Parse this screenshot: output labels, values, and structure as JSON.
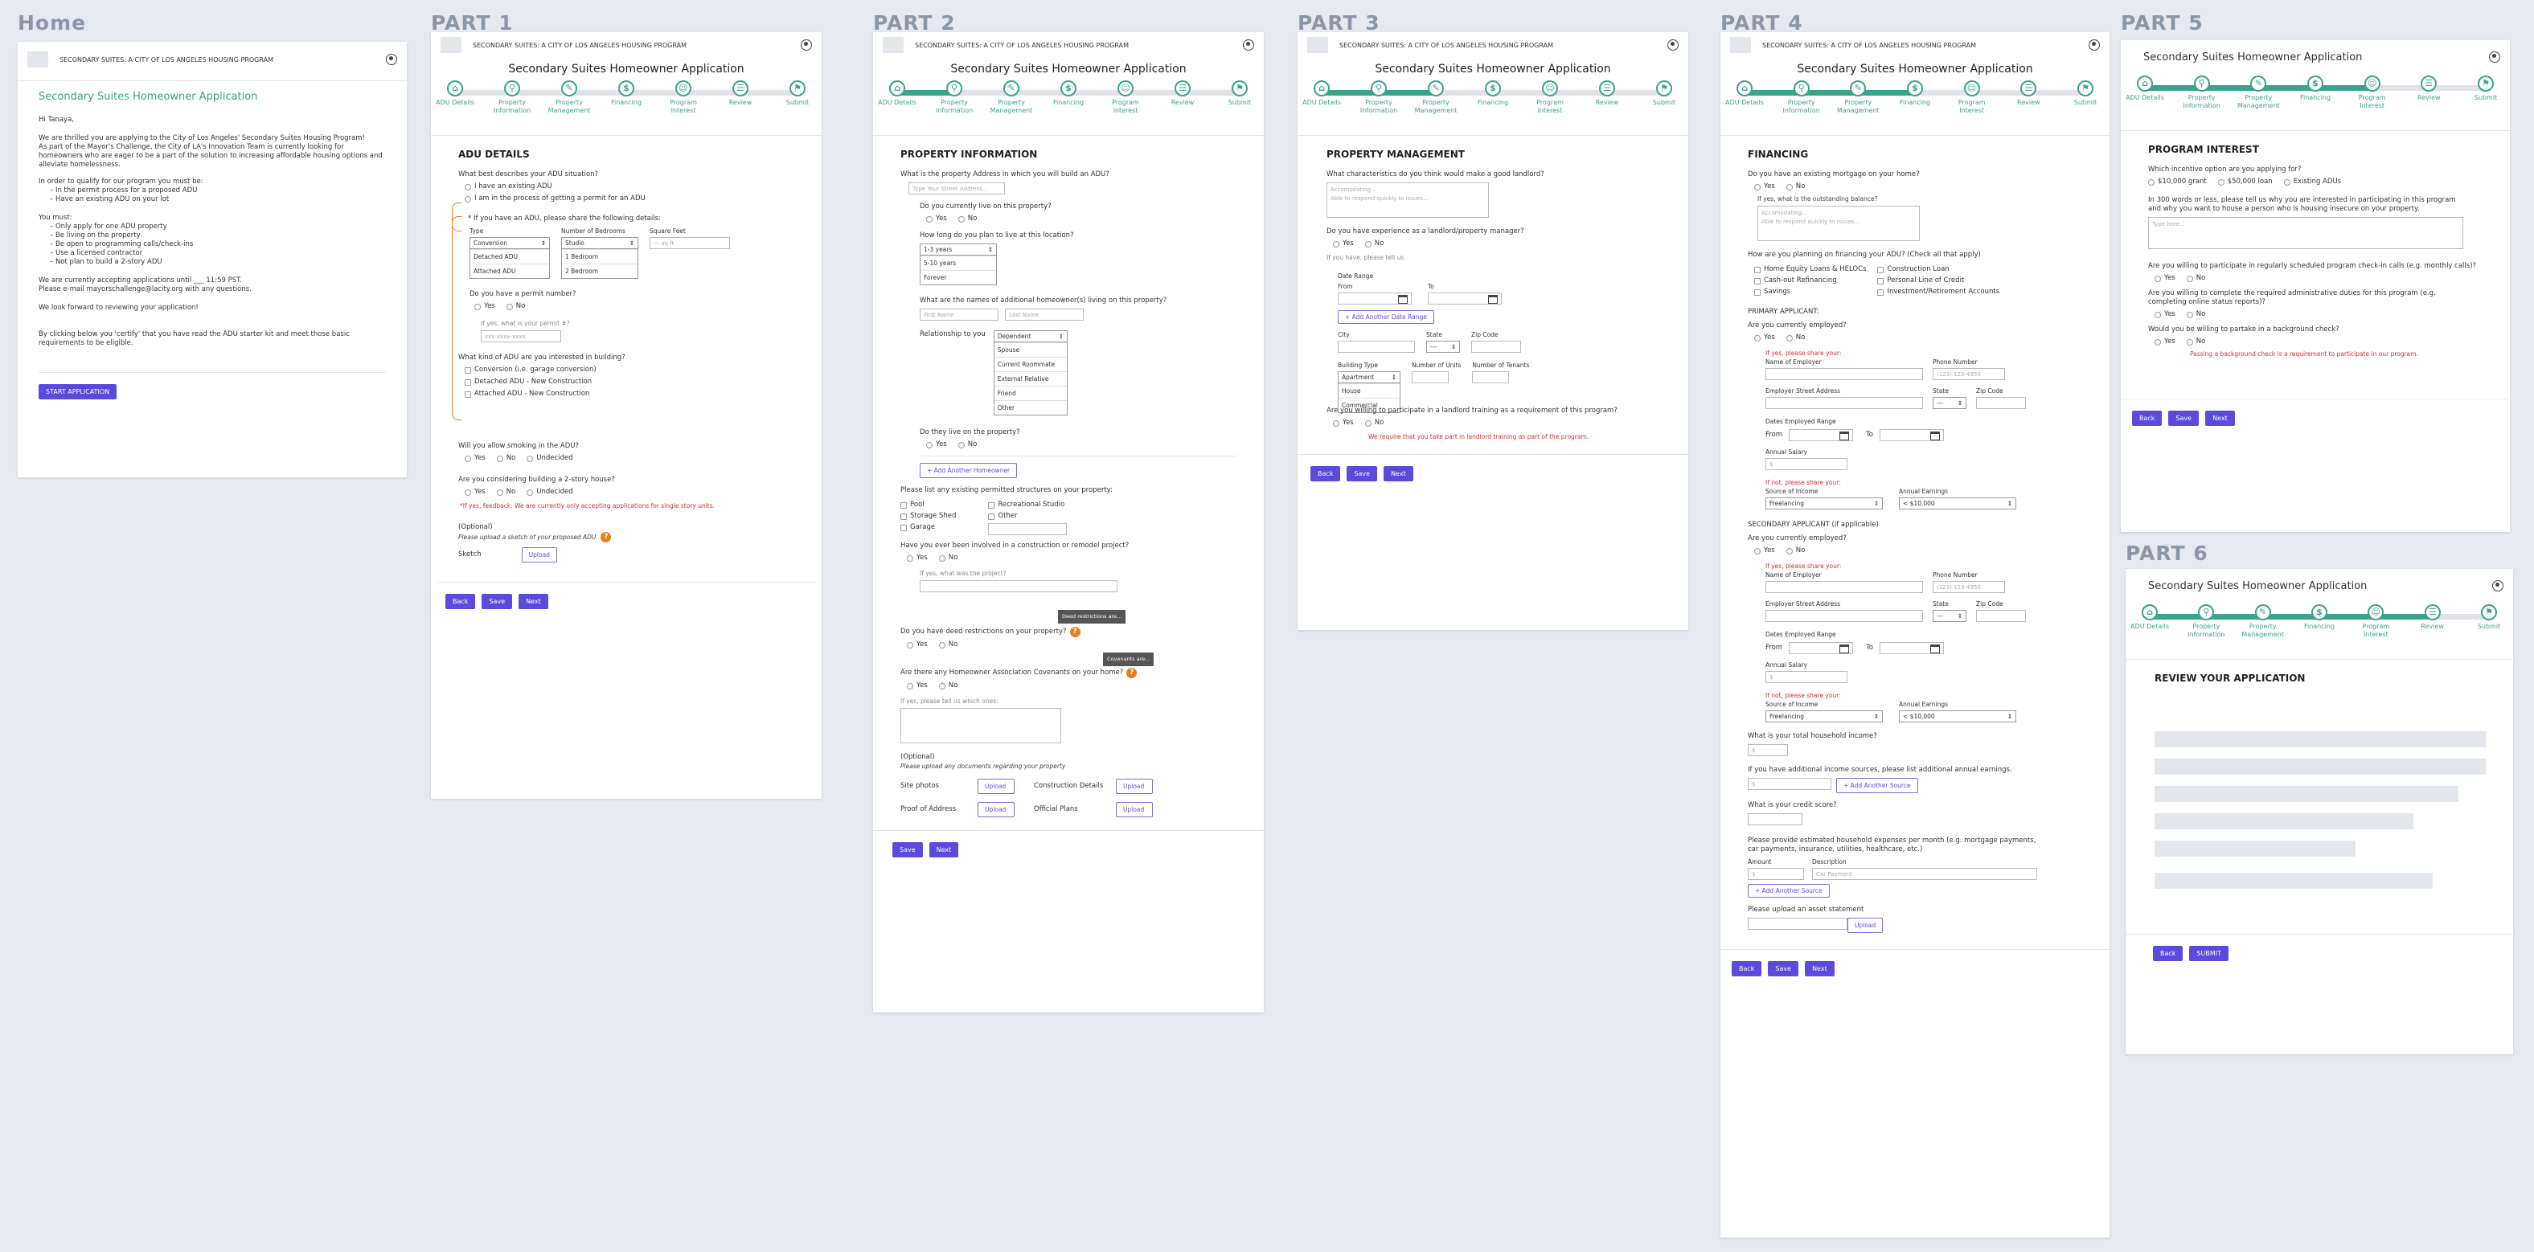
{
  "sections": {
    "home": "Home",
    "p1": "PART 1",
    "p2": "PART 2",
    "p3": "PART 3",
    "p4": "PART 4",
    "p5": "PART 5",
    "p6": "PART 6"
  },
  "topbar": "SECONDARY SUITES: A CITY OF LOS ANGELES HOUSING PROGRAM",
  "app_title": "Secondary Suites Homeowner Application",
  "steps": [
    "ADU Details",
    "Property\nInformation",
    "Property\nManagement",
    "Financing",
    "Program\nInterest",
    "Review",
    "Submit"
  ],
  "step_icons": [
    "⌂",
    "⚲",
    "✎",
    "$",
    "☺",
    "☰",
    "⚑"
  ],
  "progress": {
    "p1": 0,
    "p2": 0.166,
    "p3": 0.333,
    "p4": 0.5,
    "p5": 0.666,
    "p6": 0.833
  },
  "home": {
    "title": "Secondary Suites Homeowner Application",
    "greeting": "Hi Tanaya,",
    "para1": "We are thrilled you are applying to the City of Los Angeles' Secondary Suites Housing Program!",
    "para2": "As part of the Mayor's Challenge, the City of LA's Innovation Team is currently looking for homeowners who are eager to be a part of the solution to increasing affordable housing options and alleviate homelessness.",
    "qualify": "In order to qualify for our program you must be:",
    "q_list": [
      "In the permit process for a proposed ADU",
      "Have an existing ADU on your lot"
    ],
    "must": "You must:",
    "must_list": [
      "Only apply for one ADU property",
      "Be living on the property",
      "Be open to programming calls/check-ins",
      "Use a licensed contractor",
      "Not plan to build a 2-story ADU"
    ],
    "accepting": "We are currently accepting applications until ___ 11:59 PST.",
    "email": "Please e-mail mayorschallenge@lacity.org with any questions.",
    "look": "We look forward to reviewing your application!",
    "certify": "By clicking below you 'certify' that you have read the ADU starter kit and meet those basic requirements to be eligible.",
    "start": "START APPLICATION"
  },
  "p1": {
    "heading": "ADU DETAILS",
    "q1": "What best describes your ADU situation?",
    "q1_opts": [
      "I have an existing ADU",
      "I am in the process of getting a permit for an ADU"
    ],
    "share": "* If you have an ADU, please share the following details:",
    "col_type": "Type",
    "col_bed": "Number of Bedrooms",
    "col_sq": "Square Feet",
    "type_sel": "Conversion",
    "type_opts": [
      "Detached ADU",
      "Attached ADU"
    ],
    "bed_sel": "Studio",
    "bed_opts": [
      "1 Bedroom",
      "2 Bedroom"
    ],
    "sq_ph": "--- sq ft",
    "permit_q": "Do you have a permit number?",
    "yes": "Yes",
    "no": "No",
    "undecided": "Undecided",
    "permit_note": "If yes, what is your permit #?",
    "permit_ph": "xxx-xxxx-xxxx",
    "kind_q": "What kind of ADU are you interested in building?",
    "kind_opts": [
      "Conversion (i.e. garage conversion)",
      "Detached ADU - New Construction",
      "Attached ADU - New Construction"
    ],
    "smoke_q": "Will you allow smoking in the ADU?",
    "two_q": "Are you considering building a 2-story house?",
    "two_red": "*If yes, feedback: We are currently only accepting applications for single story units.",
    "opt": "(Optional)",
    "sketch_note": "Please upload a sketch of your proposed ADU",
    "sketch": "Sketch",
    "upload": "Upload",
    "back": "Back",
    "save": "Save",
    "next": "Next"
  },
  "p2": {
    "heading": "PROPERTY INFORMATION",
    "addr_q": "What is the property Address in which you will build an ADU?",
    "addr_ph": "Type Your Street Address...",
    "live_q": "Do you currently live on this property?",
    "long_q": "How long do you plan to live at this location?",
    "long_sel": "1-3 years",
    "long_opts": [
      "5-10 years",
      "Forever"
    ],
    "names_q": "What are the names of additional homeowner(s) living on this property?",
    "first": "First Name",
    "last": "Last Name",
    "rel": "Relationship to you",
    "rel_sel": "Dependent",
    "rel_opts": [
      "Spouse",
      "Current Roommate",
      "External Relative",
      "Friend",
      "Other"
    ],
    "they_live": "Do they live on the property?",
    "add_home": "+ Add Another Homeowner",
    "permitted": "Please list any existing permitted structures on your property:",
    "struct_l": [
      "Pool",
      "Storage Shed",
      "Garage"
    ],
    "struct_r": [
      "Recreational Studio",
      "Other"
    ],
    "remodel_q": "Have you ever been involved in a construction or remodel project?",
    "proj_note": "If yes, what was the project?",
    "deed_tip": "Deed restrictions are...",
    "deed_q": "Do you have deed restrictions on your property?",
    "cov_tip": "Covenants are...",
    "hoa_q": "Are there any Homeowner Association Covenants on your home?",
    "tell": "If yes, please tell us which ones:",
    "opt": "(Optional)",
    "docs": "Please upload any documents regarding your property",
    "site": "Site photos",
    "construct": "Construction Details",
    "proof": "Proof of Address",
    "official": "Official Plans",
    "yes": "Yes",
    "no": "No",
    "upload": "Upload",
    "save": "Save",
    "next": "Next"
  },
  "p3": {
    "heading": "PROPERTY MANAGEMENT",
    "land_q": "What characteristics do you think would make a good landlord?",
    "land_ph1": "Accomodating...",
    "land_ph2": "Able to respond quickly to issues...",
    "exp_q": "Do you have experience as a landlord/property manager?",
    "tell": "If you have, please tell us",
    "date": "Date Range",
    "from": "From",
    "to": "To",
    "add_date": "+ Add Another Date Range",
    "city": "City",
    "state": "State",
    "zip": "Zip Code",
    "state_sel": "---",
    "btype": "Building Type",
    "units": "Number of Units",
    "tenants": "Number of Tenants",
    "btype_sel": "Apartment",
    "btype_opts": [
      "House",
      "Commercial"
    ],
    "train_q": "Are you willing to participate in a landlord training as a requirement of this program?",
    "train_red": "We require that you take part in landlord training as part of the program.",
    "yes": "Yes",
    "no": "No",
    "back": "Back",
    "save": "Save",
    "next": "Next"
  },
  "p4": {
    "heading": "FINANCING",
    "mort_q": "Do you have an existing mortgage on your home?",
    "bal": "If yes, what is the outstanding balance?",
    "bal_ph1": "Accomodating...",
    "bal_ph2": "Able to respond quickly to issues...",
    "plan_q": "How are you planning on financing your ADU? (Check all that apply)",
    "fin_l": [
      "Home Equity Loans & HELOCs",
      "Cash-out Refinancing",
      "Savings"
    ],
    "fin_r": [
      "Construction Loan",
      "Personal Line of Credit",
      "Investment/Retirement Accounts"
    ],
    "primary": "PRIMARY APPLICANT:",
    "secondary": "SECONDARY APPLICANT (if applicable)",
    "emp_q": "Are you currently employed?",
    "share": "If yes, please share your:",
    "emp_name": "Name of Employer",
    "phone": "Phone Number",
    "phone_ph": "(123) 123-4950",
    "emp_addr": "Employer Street Address",
    "state": "State",
    "zip": "Zip Code",
    "state_sel": "---",
    "dates": "Dates Employed Range",
    "from": "From",
    "to": "To",
    "salary": "Annual Salary",
    "dollar": "$",
    "no_share": "If not, please share your:",
    "source": "Source of Income",
    "earn": "Annual Earnings",
    "source_sel": "Freelancing",
    "earn_sel": "< $10,000",
    "total_q": "What is your total household income?",
    "add_inc": "If you have additional income sources, please list additional annual earnings.",
    "add_source": "+ Add Another Source",
    "credit_q": "What is your credit score?",
    "exp_q": "Please provide estimated household expenses per month (e.g. mortgage payments, car payments, insurance, utilities, healthcare, etc.)",
    "amount": "Amount",
    "desc": "Description",
    "desc_ph": "Car Payment",
    "asset": "Please upload an asset statement",
    "yes": "Yes",
    "no": "No",
    "upload": "Upload",
    "back": "Back",
    "save": "Save",
    "next": "Next"
  },
  "p5": {
    "heading": "PROGRAM INTEREST",
    "inc_q": "Which incentive option are you applying for?",
    "inc_opts": [
      "$10,000 grant",
      "$50,000 loan",
      "Existing ADUs"
    ],
    "why_q": "In 300 words or less, please tell us why you are interested in participating in this program and why you want to house a person who is housing insecure on your property.",
    "why_ph": "Type here...",
    "check_q": "Are you willing to participate in regularly scheduled program check-in calls (e.g. monthly calls)?",
    "admin_q": "Are you willing to complete the required administrative duties for this program (e.g. completing online status reports)?",
    "bg_q": "Would you be willing to partake in a background check?",
    "bg_red": "Passing a background check is a requirement to participate in our program.",
    "yes": "Yes",
    "no": "No",
    "back": "Back",
    "save": "Save",
    "next": "Next"
  },
  "p6": {
    "heading": "REVIEW YOUR APPLICATION",
    "back": "Back",
    "submit": "SUBMIT"
  },
  "colors": {
    "accent": "#3aa38c",
    "button": "#5b4bdb",
    "warn": "#e67e22",
    "error": "#d32f2f"
  }
}
